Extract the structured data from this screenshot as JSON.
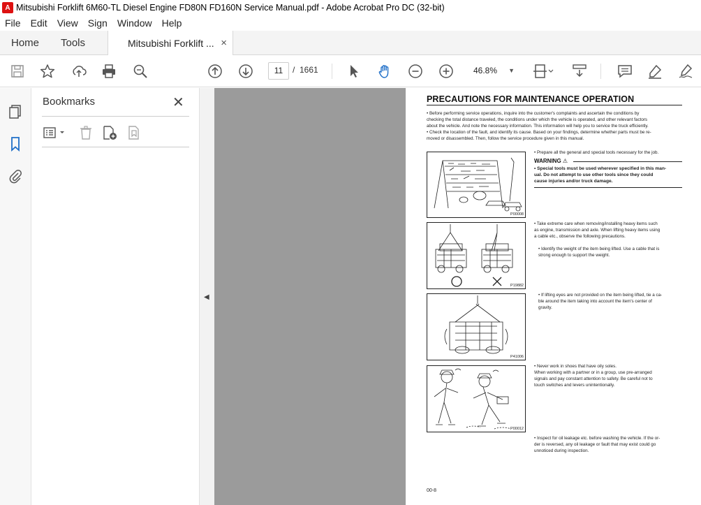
{
  "window": {
    "title": "Mitsubishi Forklift 6M60-TL Diesel Engine FD80N FD160N Service Manual.pdf - Adobe Acrobat Pro DC (32-bit)"
  },
  "menu": [
    "File",
    "Edit",
    "View",
    "Sign",
    "Window",
    "Help"
  ],
  "tabs": {
    "home": "Home",
    "tools": "Tools",
    "document": "Mitsubishi Forklift ...",
    "close": "×"
  },
  "toolbar": {
    "current_page": "11",
    "page_separator": "/",
    "total_pages": "1661",
    "zoom": "46.8%"
  },
  "bookmarks": {
    "title": "Bookmarks",
    "close": "✕"
  },
  "icons": [
    "save-icon",
    "star-icon",
    "upload-icon",
    "print-icon",
    "zoom-search-icon",
    "page-up-icon",
    "page-down-icon",
    "select-arrow-icon",
    "hand-icon",
    "zoom-out-icon",
    "zoom-in-icon",
    "fit-page-icon",
    "scroll-mode-icon",
    "comment-icon",
    "highlight-icon",
    "sign-icon",
    "thumbnails-icon",
    "bookmark-icon",
    "attachment-icon",
    "bookmark-options-icon",
    "delete-icon",
    "new-bookmark-icon",
    "bookmark-properties-icon",
    "collapse-arrow-icon"
  ],
  "document": {
    "heading": "PRECAUTIONS FOR MAINTENANCE OPERATION",
    "intro": [
      "•  Before performing service operations, inquire into the customer's complaints and ascertain the conditions by",
      "   checking the total distance traveled, the conditions under which the vehicle is operated, and other relevant factors",
      "   about the vehicle. And note the necessary information. This information will help you to service the truck efficiently.",
      "•  Check the location of the fault, and identify its cause. Based on your findings, determine whether parts must be re-",
      "   moved or disassembled. Then, follow the service procedure given in this manual."
    ],
    "tools_note": "•  Prepare all the general and special tools necessary for the job.",
    "warning_label": "WARNING ⚠",
    "warning_text": [
      "•  Special tools must be used wherever specified in this man-",
      "   ual. Do not attempt to use other tools since they could",
      "   cause injuries and/or truck damage."
    ],
    "heavy_items": [
      "•  Take extreme care when removing/installing heavy items such",
      "   as engine, transmission and axle. When lifting heavy items using",
      "   a cable etc., observe the following precautions."
    ],
    "weight_note": [
      "•  Identify the weight of the item being lifted. Use a cable that is",
      "   strong enough to support the weight."
    ],
    "lifting_eyes": [
      "•  If lifting eyes are not provided on the item being lifted, tie a ca-",
      "   ble around the item taking into account the item's center of",
      "   gravity."
    ],
    "shoes": [
      "•  Never work in shoes that have oily soles.",
      "   When working with a partner or in a group, use pre-arranged",
      "   signals and pay constant attention to safety. Be careful not to",
      "   touch switches and levers unintentionally."
    ],
    "leakage": [
      "•  Inspect for oil leakage etc. before washing the vehicle. If the or-",
      "   der is reversed, any oil leakage or fault that may exist could go",
      "   unnoticed during inspection."
    ],
    "figure_codes": [
      "P00008",
      "P19882",
      "P41006",
      "P00012"
    ],
    "page_number": "00-8"
  }
}
